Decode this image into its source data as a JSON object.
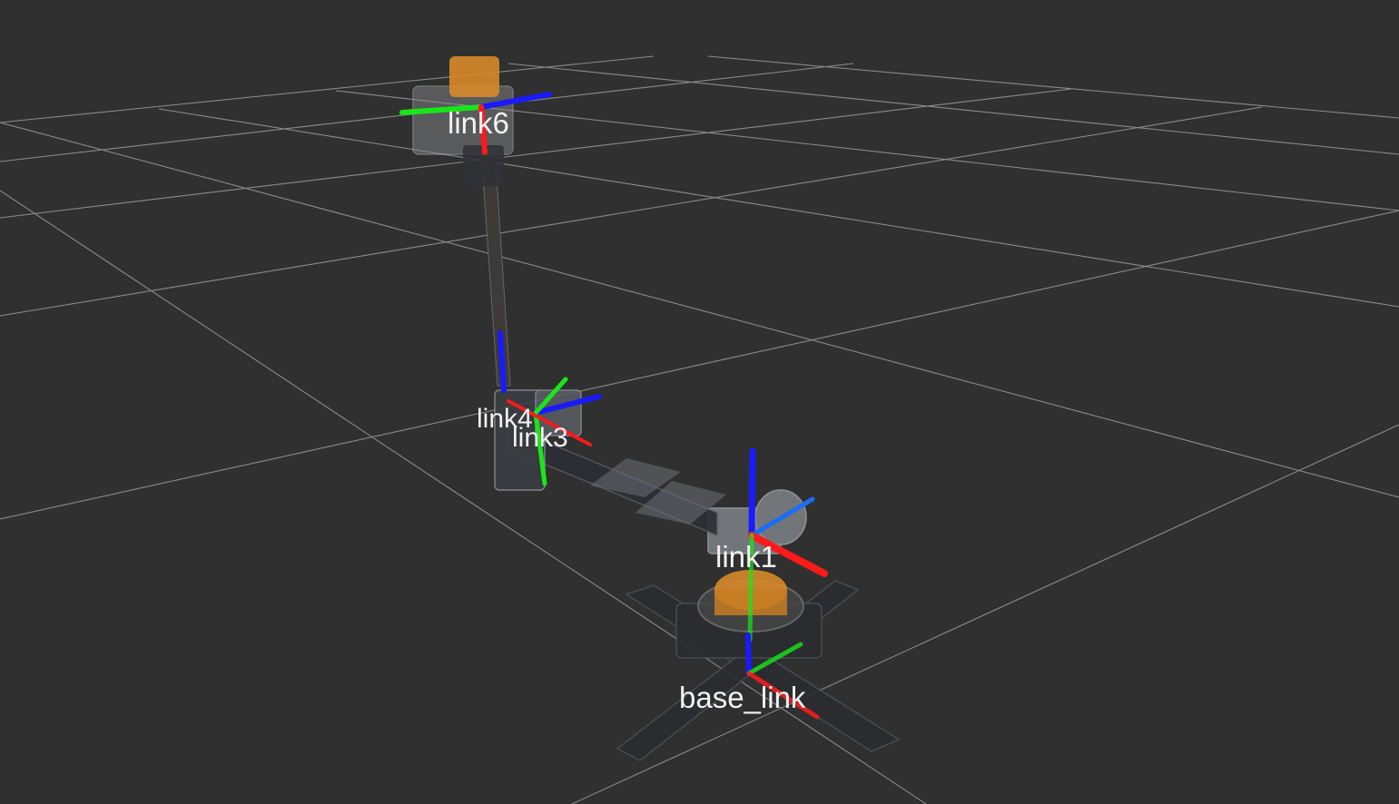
{
  "viewport": {
    "background": "#303030",
    "grid_color": "#9a9a9a",
    "axis_colors": {
      "x": "#ff1a1a",
      "y": "#19e619",
      "z": "#1a1aff"
    },
    "mesh_color_highlight": "#e8952a"
  },
  "frames": [
    {
      "label": "link6"
    },
    {
      "label": "link4"
    },
    {
      "label": "link3"
    },
    {
      "label": "link1"
    },
    {
      "label": "base_link"
    }
  ]
}
